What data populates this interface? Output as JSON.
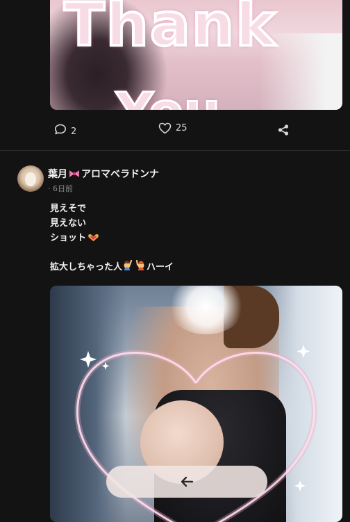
{
  "previous_post": {
    "image_text_line1": "Thank",
    "image_text_line2": "You",
    "comment_count": "2",
    "like_count": "25"
  },
  "post": {
    "author_name": "葉月🎀アロマベラドンナ",
    "author_name_main": "葉月",
    "author_name_rest": "アロマベラドンナ",
    "timestamp": "6日前",
    "text_lines": [
      "見えそで",
      "見えない",
      "ショット🫶",
      "",
      "拡大しちゃった人🙋🙋ハーイ"
    ],
    "line1": "見えそで",
    "line2": "見えない",
    "line3_text": "ショット",
    "line5_text_a": "拡大しちゃった人",
    "line5_text_b": "ハーイ"
  },
  "icons": [
    "comment-icon",
    "heart-icon",
    "share-icon",
    "bow-icon",
    "heart-hands-emoji",
    "raising-hand-emoji",
    "back-arrow-icon"
  ],
  "colors": {
    "background": "#131313",
    "text": "#f0f0f0",
    "muted": "#8b8b8b",
    "divider": "#2c2c2c"
  }
}
